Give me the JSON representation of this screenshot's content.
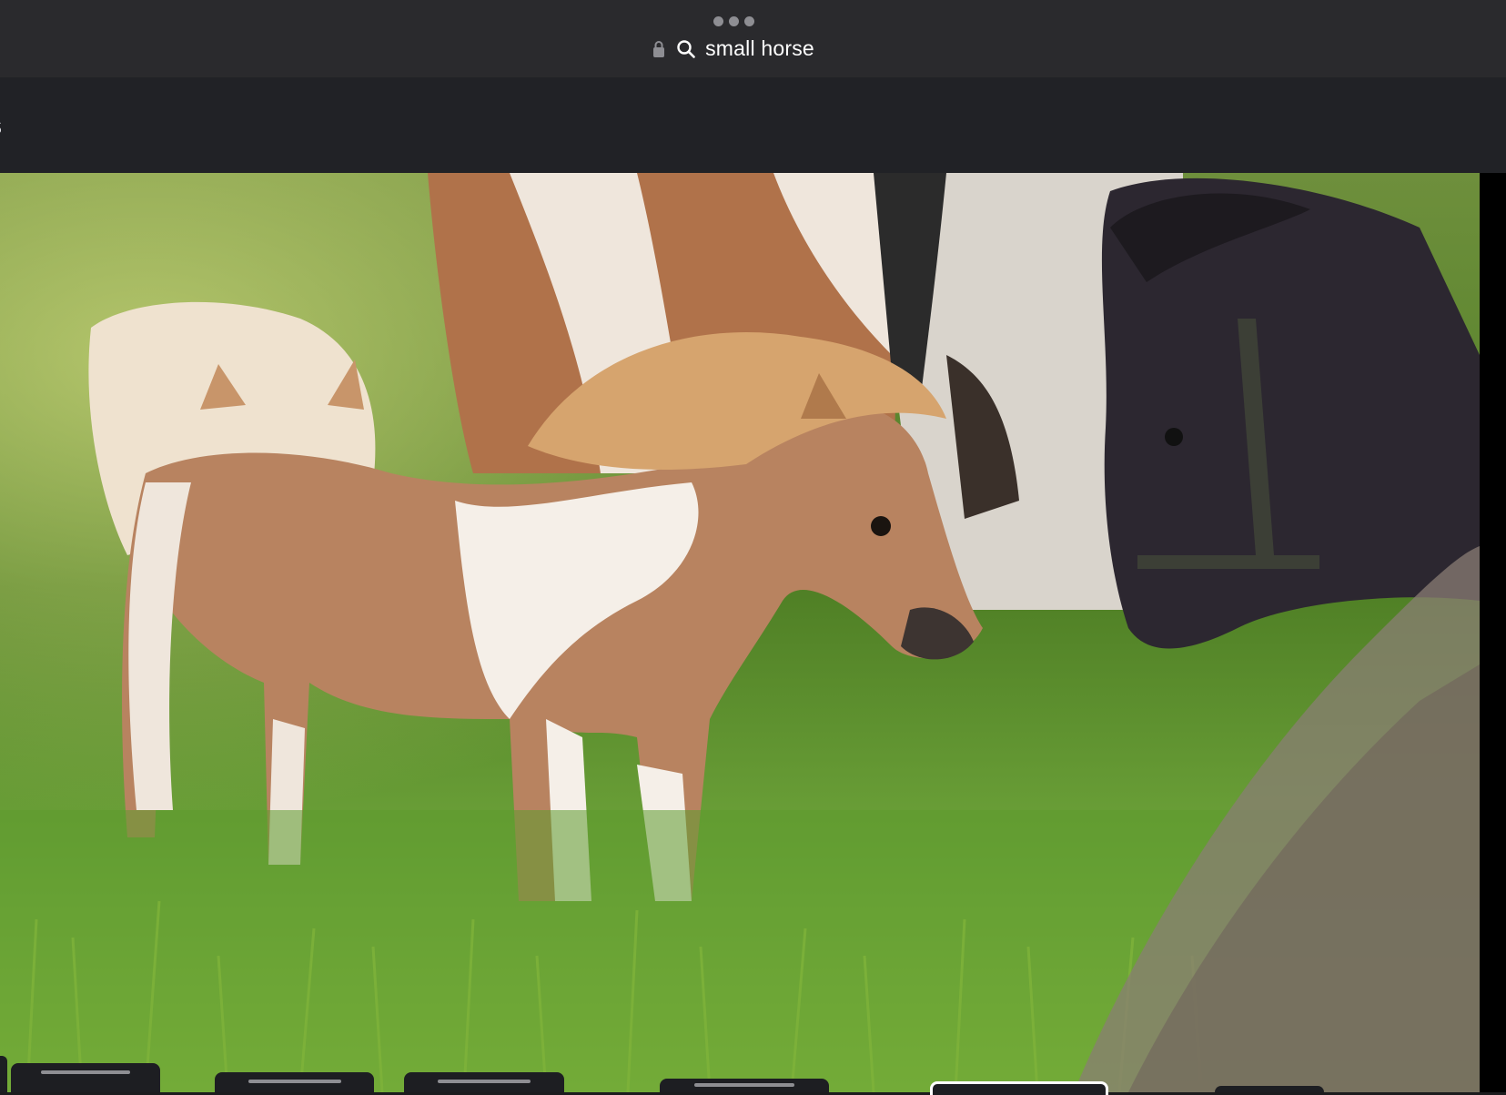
{
  "browser": {
    "search_query": "small horse",
    "icons": [
      "more-dots-icon",
      "lock-icon",
      "search-icon"
    ]
  },
  "toolbar": {
    "partial_label": "s"
  },
  "image_viewer": {
    "image_description_icon": "photo-image"
  },
  "colors": {
    "topbar_bg": "#2a2a2d",
    "subbar_bg": "#212226",
    "text": "#ffffff",
    "accent_active": "#ffffff"
  }
}
